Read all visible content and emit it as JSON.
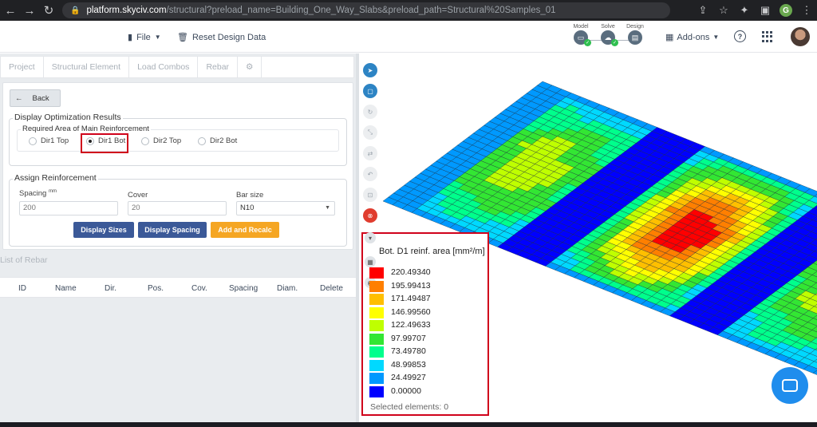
{
  "browser": {
    "url_host": "platform.skyciv.com",
    "url_path": "/structural?preload_name=Building_One_Way_Slabs&preload_path=Structural%20Samples_01",
    "profile_initial": "G"
  },
  "header": {
    "file_label": "File",
    "reset_label": "Reset Design Data",
    "stages": [
      "Model",
      "Solve",
      "Design"
    ],
    "addons_label": "Add-ons",
    "help_glyph": "?"
  },
  "tabs": [
    "Project",
    "Structural Element",
    "Load Combos",
    "Rebar"
  ],
  "panel": {
    "back_label": "Back",
    "display_section": "Display Optimization Results",
    "required_area_label": "Required Area of Main Reinforcement",
    "radio_options": [
      "Dir1 Top",
      "Dir1 Bot",
      "Dir2 Top",
      "Dir2 Bot"
    ],
    "selected_option": "Dir1 Bot",
    "assign_section": "Assign Reinforcement",
    "spacing_label": "Spacing",
    "spacing_unit": "mm",
    "spacing_value": "200",
    "cover_label": "Cover",
    "cover_value": "20",
    "barsize_label": "Bar size",
    "barsize_value": "N10",
    "btn_display_sizes": "Display Sizes",
    "btn_display_spacing": "Display Spacing",
    "btn_add_recalc": "Add and Recalc"
  },
  "rebar_list": {
    "title": "List of Rebar",
    "columns": [
      "ID",
      "Name",
      "Dir.",
      "Pos.",
      "Cov.",
      "Spacing",
      "Diam.",
      "Delete"
    ]
  },
  "legend": {
    "title": "Bot. D1 reinf. area [mm²/m]",
    "values": [
      "220.49340",
      "195.99413",
      "171.49487",
      "146.99560",
      "122.49633",
      "97.99707",
      "73.49780",
      "48.99853",
      "24.49927",
      "0.00000"
    ],
    "colors": [
      "#ff0000",
      "#ff7f00",
      "#ffbf00",
      "#ffff00",
      "#bfff00",
      "#33e633",
      "#00ff8c",
      "#00d9ff",
      "#0099ff",
      "#0000ff"
    ],
    "selected_elements": "Selected elements: 0"
  },
  "colors": {
    "accent_blue": "#2d84c4",
    "btn_navy": "#3b5998",
    "btn_orange": "#f5a623",
    "highlight_red": "#d0021b"
  }
}
